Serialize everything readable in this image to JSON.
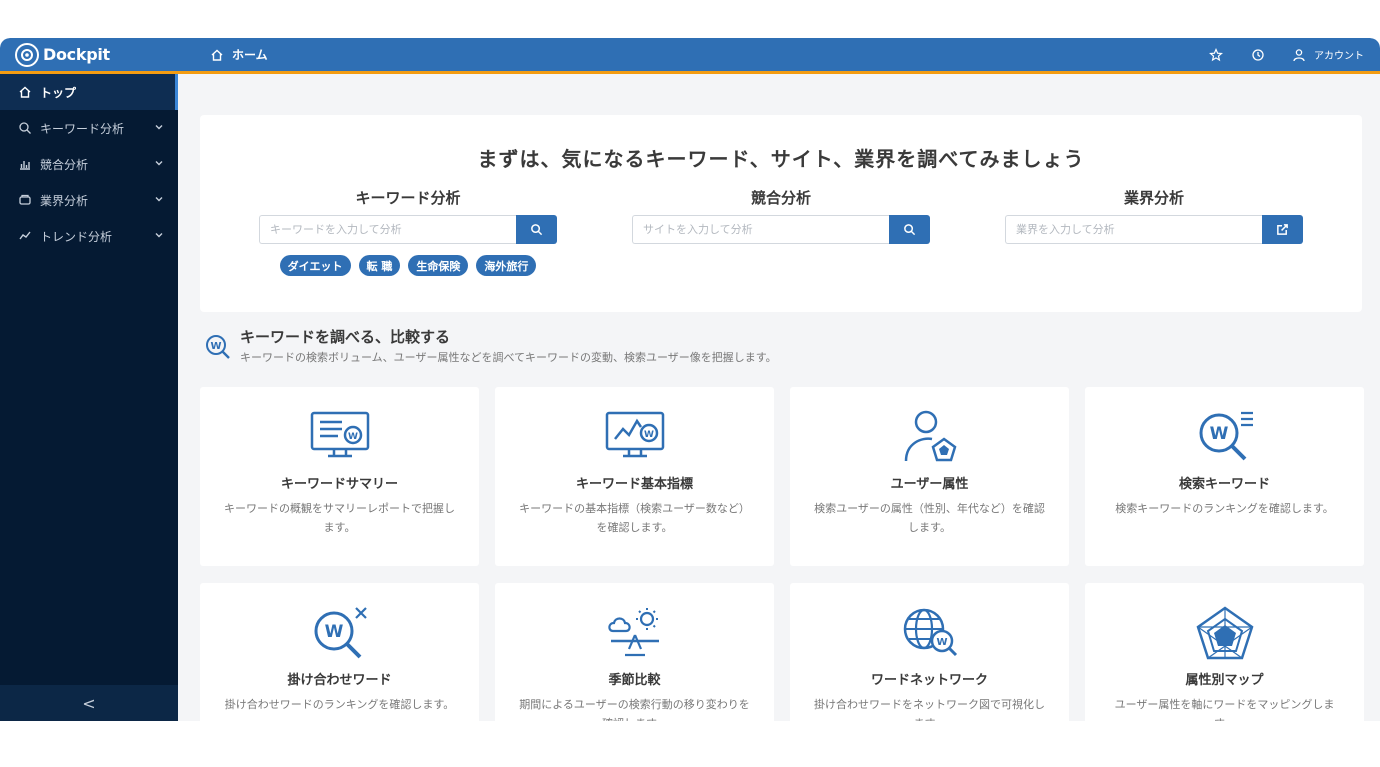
{
  "brand": {
    "name": "Dockpit"
  },
  "header": {
    "breadcrumb": "ホーム",
    "account_label": "アカウント"
  },
  "sidebar": {
    "items": [
      {
        "label": "トップ",
        "icon": "home-icon"
      },
      {
        "label": "キーワード分析",
        "icon": "search-icon"
      },
      {
        "label": "競合分析",
        "icon": "chart-icon"
      },
      {
        "label": "業界分析",
        "icon": "industry-icon"
      },
      {
        "label": "トレンド分析",
        "icon": "trend-icon"
      }
    ],
    "collapse_label": "<"
  },
  "hero": {
    "title": "まずは、気になるキーワード、サイト、業界を調べてみましょう",
    "keyword": {
      "label": "キーワード分析",
      "placeholder": "キーワードを入力して分析"
    },
    "competitor": {
      "label": "競合分析",
      "placeholder": "サイトを入力して分析"
    },
    "industry": {
      "label": "業界分析",
      "placeholder": "業界を入力して分析"
    },
    "tags": [
      "ダイエット",
      "転 職",
      "生命保険",
      "海外旅行"
    ]
  },
  "section": {
    "title": "キーワードを調べる、比較する",
    "description": "キーワードの検索ボリューム、ユーザー属性などを調べてキーワードの変動、検索ユーザー像を把握します。"
  },
  "cards": [
    {
      "title": "キーワードサマリー",
      "desc": "キーワードの概観をサマリーレポートで把握します。",
      "icon": "monitor-report-icon"
    },
    {
      "title": "キーワード基本指標",
      "desc": "キーワードの基本指標（検索ユーザー数など）を確認します。",
      "icon": "monitor-chart-icon"
    },
    {
      "title": "ユーザー属性",
      "desc": "検索ユーザーの属性（性別、年代など）を確認します。",
      "icon": "user-attribute-icon"
    },
    {
      "title": "検索キーワード",
      "desc": "検索キーワードのランキングを確認します。",
      "icon": "search-keyword-icon"
    },
    {
      "title": "掛け合わせワード",
      "desc": "掛け合わせワードのランキングを確認します。",
      "icon": "combine-word-icon"
    },
    {
      "title": "季節比較",
      "desc": "期間によるユーザーの検索行動の移り変わりを確認します。",
      "icon": "season-icon"
    },
    {
      "title": "ワードネットワーク",
      "desc": "掛け合わせワードをネットワーク図で可視化します。",
      "icon": "network-icon"
    },
    {
      "title": "属性別マップ",
      "desc": "ユーザー属性を軸にワードをマッピングします。",
      "icon": "radar-map-icon"
    }
  ],
  "colors": {
    "primary": "#2f6fb4",
    "sidebar": "#051a33",
    "accent": "#f39c12"
  }
}
